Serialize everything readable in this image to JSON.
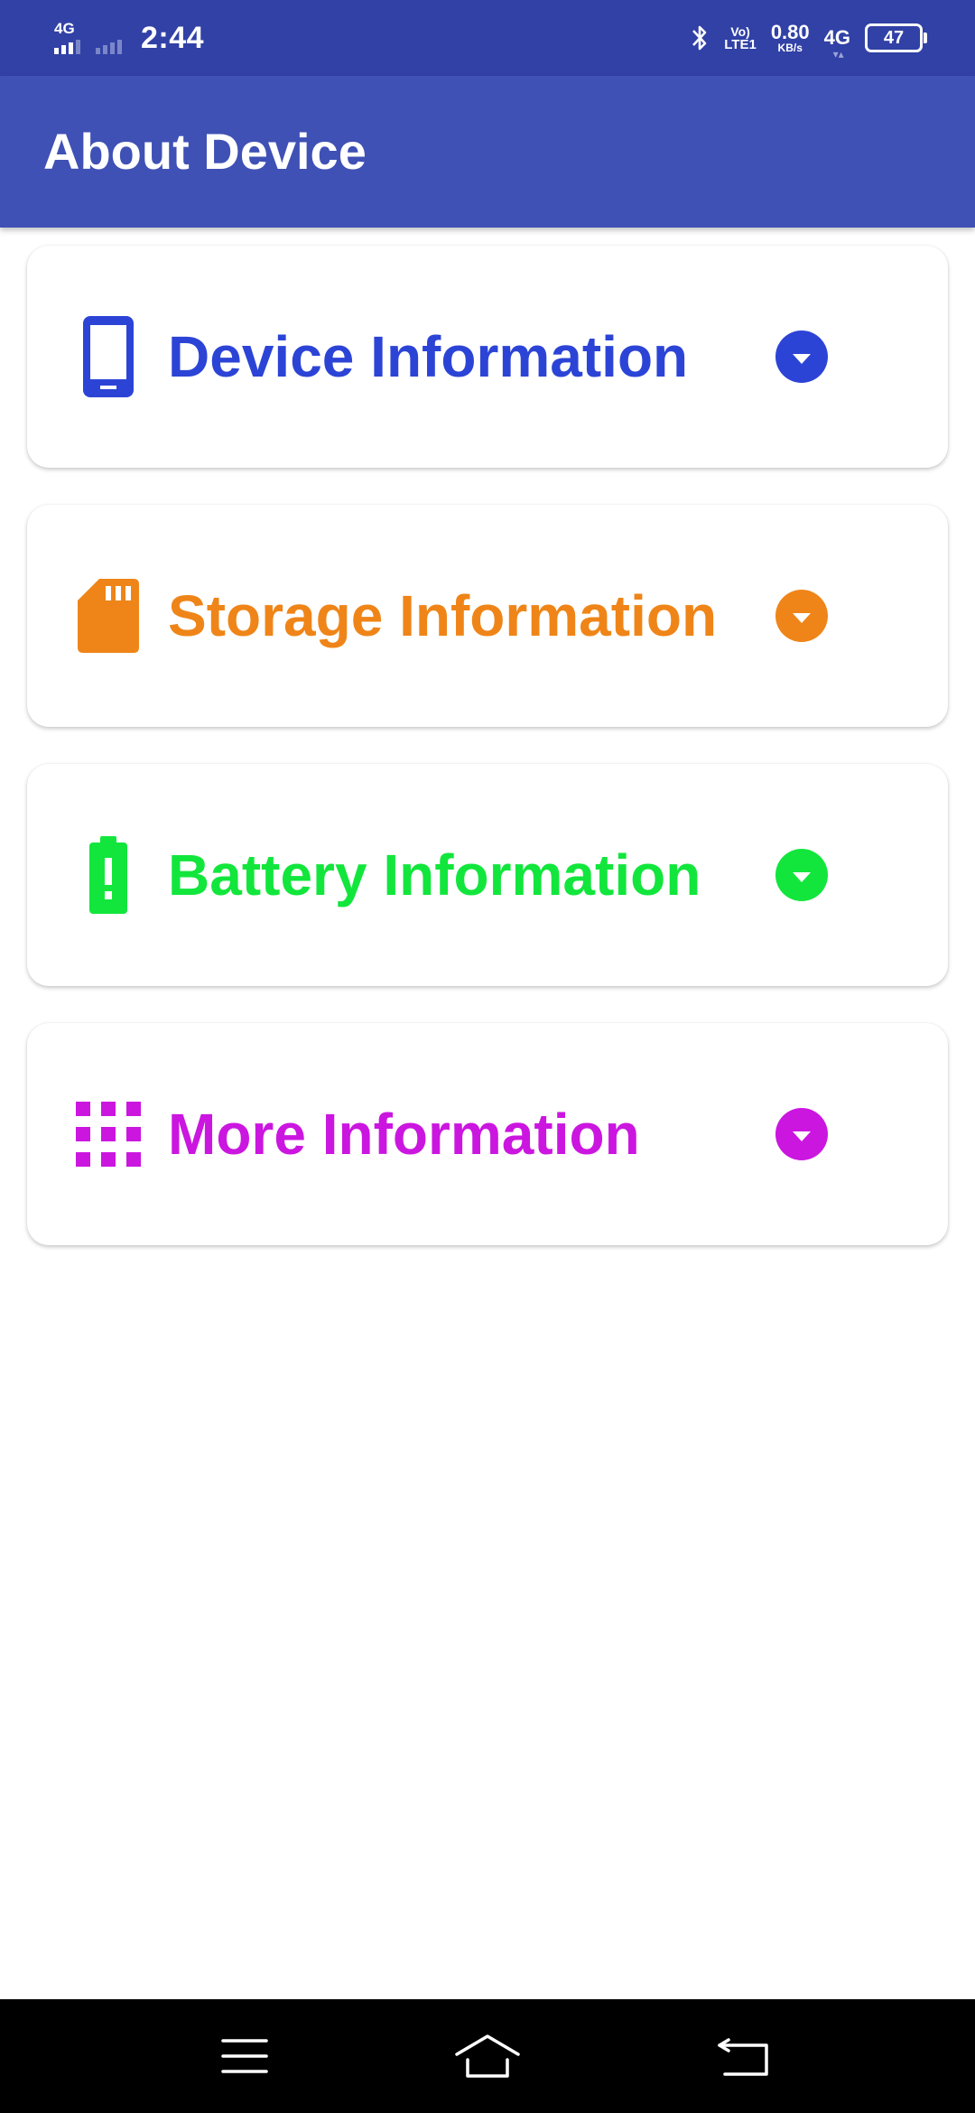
{
  "status_bar": {
    "time": "2:44",
    "sim1_network": "4G",
    "volte_top": "Vo)",
    "volte_bottom": "LTE1",
    "speed_value": "0.80",
    "speed_unit": "KB/s",
    "network_type": "4G",
    "battery_level": "47",
    "bluetooth_icon": "bluetooth-icon"
  },
  "app_bar": {
    "title": "About Device"
  },
  "sections": [
    {
      "title": "Device Information",
      "color": "#2c44d6",
      "icon": "smartphone-icon"
    },
    {
      "title": "Storage Information",
      "color": "#ef8518",
      "icon": "sd-card-icon"
    },
    {
      "title": "Battery Information",
      "color": "#12e63c",
      "icon": "battery-alert-icon"
    },
    {
      "title": "More Information",
      "color": "#cb16e0",
      "icon": "apps-grid-icon"
    }
  ],
  "nav_bar": {
    "menu_icon": "menu-icon",
    "home_icon": "home-icon",
    "back_icon": "back-icon"
  }
}
